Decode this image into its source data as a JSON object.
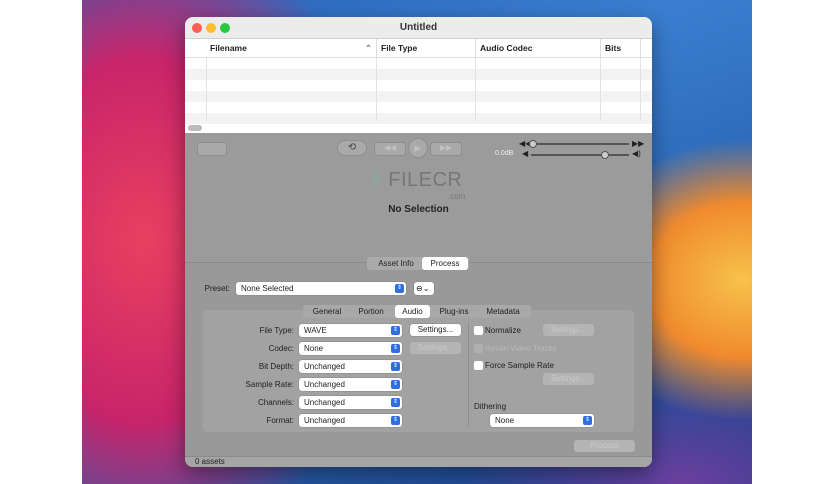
{
  "window": {
    "title": "Untitled"
  },
  "table": {
    "columns": [
      "Filename",
      "File Type",
      "Audio Codec",
      "Bits"
    ],
    "sort_indicator": "^"
  },
  "player": {
    "volume_label": "0.0dB",
    "rate": 0.05,
    "volume": 0.85
  },
  "watermark": {
    "text": "FILECR",
    ".com": ".com",
    "sub": ".com"
  },
  "selection": "No Selection",
  "panel_tabs": [
    "Asset Info",
    "Process"
  ],
  "preset": {
    "label": "Preset:",
    "value": "None Selected"
  },
  "tabs": [
    "General",
    "Portion",
    "Audio",
    "Plug-ins",
    "Metadata"
  ],
  "fields": [
    {
      "label": "File Type:",
      "value": "WAVE"
    },
    {
      "label": "Codec:",
      "value": "None"
    },
    {
      "label": "Bit Depth:",
      "value": "Unchanged"
    },
    {
      "label": "Sample Rate:",
      "value": "Unchanged"
    },
    {
      "label": "Channels:",
      "value": "Unchanged"
    },
    {
      "label": "Format:",
      "value": "Unchanged"
    }
  ],
  "settings_label": "Settings...",
  "options": {
    "normalize": "Normalize",
    "retain": "Retain Video Tracks",
    "force": "Force Sample Rate",
    "dithering": "Dithering",
    "dithering_value": "None"
  },
  "process_button": "Process",
  "status": "0 assets"
}
